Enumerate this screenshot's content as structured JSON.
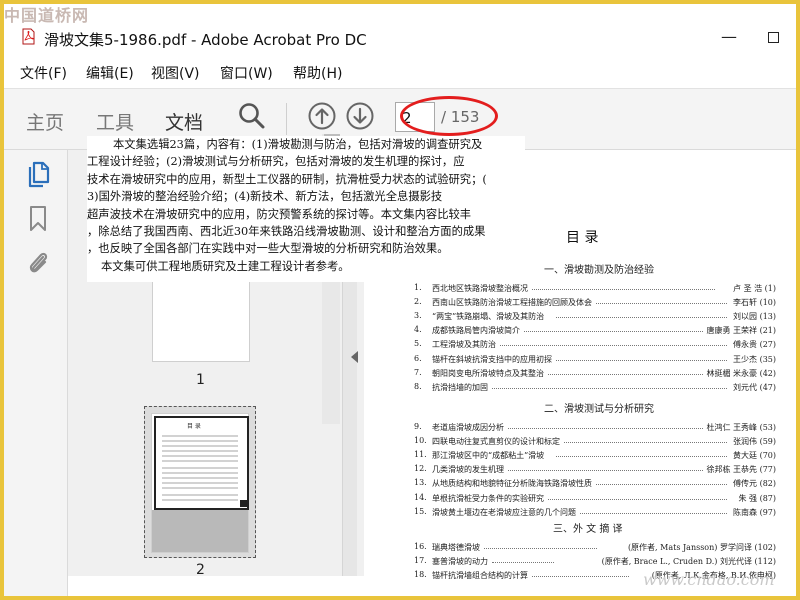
{
  "watermark_top": "中国道桥网",
  "watermark_bottom": "www.cndao.com",
  "window": {
    "title": "滑坡文集5-1986.pdf - Adobe Acrobat Pro DC",
    "pdf_icon": "pdf-file-icon",
    "minimize_glyph": "—",
    "maximize_glyph": "☐"
  },
  "menu": [
    "文件(F)",
    "编辑(E)",
    "视图(V)",
    "窗口(W)",
    "帮助(H)"
  ],
  "toolbar": {
    "tabs": [
      "主页",
      "工具",
      "文档"
    ],
    "active_tab": "文档",
    "search_icon": "search-icon",
    "prev_icon": "arrow-up-circle-icon",
    "next_icon": "arrow-down-circle-icon",
    "page_value": "2",
    "page_total": "/ 153",
    "highlight_color": "#e31d1d"
  },
  "leftrail": {
    "icons": [
      "page-thumbnails-icon",
      "bookmark-icon",
      "attachment-icon"
    ],
    "accent": "#2b6fba"
  },
  "thumbnails": [
    {
      "label": "1",
      "page_title": "",
      "selected": false
    },
    {
      "label": "2",
      "page_title": "目 录",
      "selected": true
    }
  ],
  "overlay_lines": [
    "本文集选辑23篇，内容有：(1)滑坡勘测与防治，包括对滑坡的调查研究及",
    "工程设计经验；(2)滑坡测试与分析研究，包括对滑坡的发生机理的探讨，应",
    "技术在滑坡研究中的应用，新型土工仪器的研制，抗滑桩受力状态的试验研究；(",
    "3)国外滑坡的整治经验介绍；(4)新技术、新方法，包括激光全息摄影技",
    "超声波技术在滑坡研究中的应用，防灾预警系统的探讨等。本文集内容比较丰",
    "，除总结了我国西南、西北近30年来铁路沿线滑坡勘测、设计和整治方面的成果",
    "，也反映了全国各部门在实践中对一些大型滑坡的分析研究和防治效果。",
    "本文集可供工程地质研究及土建工程设计者参考。"
  ],
  "toc": {
    "heading": "目 录",
    "sections": [
      {
        "title": "一、滑坡勘测及防治经验",
        "entries": [
          {
            "n": "1.",
            "title": "西北地区铁路滑坡整治概况",
            "author": "卢 圣 浩",
            "page": "(1)"
          },
          {
            "n": "2.",
            "title": "西南山区铁路防治滑坡工程措施的回顾及体会",
            "author": "李石轩",
            "page": "(10)"
          },
          {
            "n": "3.",
            "title": "“两宝”铁路崩塌、滑坡及其防治",
            "author": "刘以园",
            "page": "(13)"
          },
          {
            "n": "4.",
            "title": "成都铁路局管内滑坡简介",
            "author": "唐康勇 王荣祥",
            "page": "(21)"
          },
          {
            "n": "5.",
            "title": "工程滑坡及其防治",
            "author": "傅永贵",
            "page": "(27)"
          },
          {
            "n": "6.",
            "title": "锚杆在斜坡抗滑支挡中的应用初探",
            "author": "王少杰",
            "page": "(35)"
          },
          {
            "n": "7.",
            "title": "朝阳岗变电所滑坡特点及其整治",
            "author": "林挺楣 米永豪",
            "page": "(42)"
          },
          {
            "n": "8.",
            "title": "抗滑挡墙的加固",
            "author": "刘元代",
            "page": "(47)"
          }
        ]
      },
      {
        "title": "二、滑坡测试与分析研究",
        "entries": [
          {
            "n": "9.",
            "title": "老道庙滑坡成因分析",
            "author": "杜鸿仁 王秀峰",
            "page": "(53)"
          },
          {
            "n": "10.",
            "title": "四联电动往复式直剪仪的设计和标定",
            "author": "张润伟",
            "page": "(59)"
          },
          {
            "n": "11.",
            "title": "那江滑坡区中的“成都粘土”滑坡",
            "author": "黄大廷",
            "page": "(70)"
          },
          {
            "n": "12.",
            "title": "几类滑坡的发生机理",
            "author": "徐邦栋 王恭先",
            "page": "(77)"
          },
          {
            "n": "13.",
            "title": "从地质结构和地貌特征分析陇海铁路滑坡性质",
            "author": "傅传元",
            "page": "(82)"
          },
          {
            "n": "14.",
            "title": "单根抗滑桩受力条件的实验研究",
            "author": "朱 强",
            "page": "(87)"
          },
          {
            "n": "15.",
            "title": "滑坡黄土堰边在老滑坡应注意的几个问题",
            "author": "陈南森",
            "page": "(97)"
          }
        ]
      },
      {
        "title": "三、外 文 摘 译",
        "entries": [
          {
            "n": "16.",
            "title": "瑞典塔德滑坡",
            "author": "(原作者, Mats Jansson) 罗学问译",
            "page": "(102)"
          },
          {
            "n": "17.",
            "title": "塞普滑坡的动力",
            "author": "(原作者, Brace L., Cruden D.) 刘光代译",
            "page": "(112)"
          },
          {
            "n": "18.",
            "title": "锚杆抗滑墙组合结构的计算",
            "author": "(原作者, Л.К.金布格, В.И.依申柯)",
            "page": ""
          }
        ]
      }
    ]
  }
}
